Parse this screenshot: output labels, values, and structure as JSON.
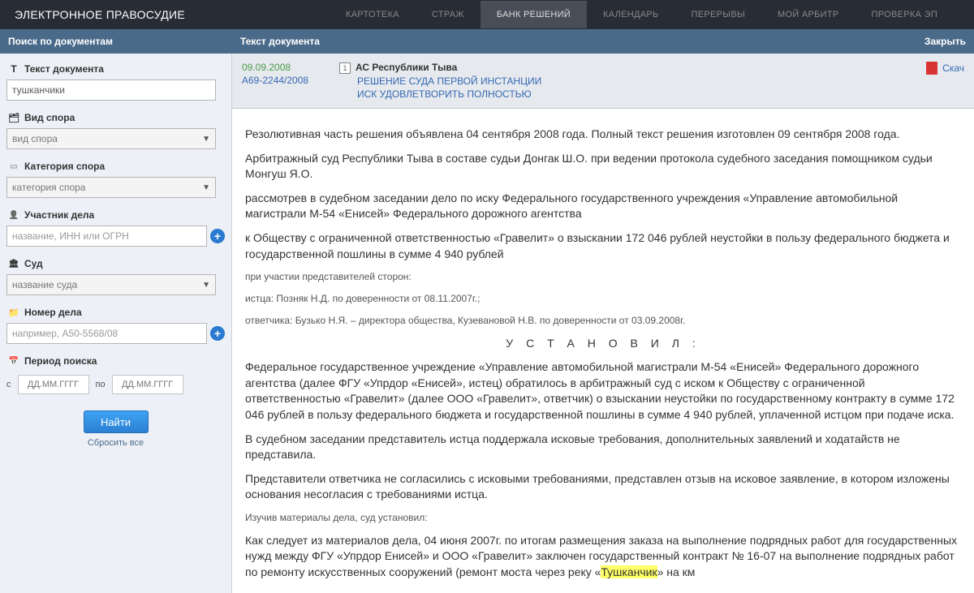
{
  "header": {
    "logo": "ЭЛЕКТРОННОЕ ПРАВОСУДИЕ",
    "nav": [
      {
        "label": "КАРТОТЕКА"
      },
      {
        "label": "СТРАЖ"
      },
      {
        "label": "БАНК РЕШЕНИЙ",
        "active": true
      },
      {
        "label": "КАЛЕНДАРЬ"
      },
      {
        "label": "ПЕРЕРЫВЫ"
      },
      {
        "label": "МОЙ АРБИТР"
      },
      {
        "label": "ПРОВЕРКА ЭП"
      }
    ]
  },
  "subheader": {
    "left": "Поиск по документам",
    "mid": "Текст документа",
    "right": "Закрыть"
  },
  "sidebar": {
    "text_label": "Текст документа",
    "text_value": "тушканчики",
    "type_label": "Вид спора",
    "type_placeholder": "вид спора",
    "cat_label": "Категория спора",
    "cat_placeholder": "категория спора",
    "party_label": "Участник дела",
    "party_placeholder": "название, ИНН или ОГРН",
    "court_label": "Суд",
    "court_placeholder": "название суда",
    "case_label": "Номер дела",
    "case_placeholder": "например, А50-5568/08",
    "period_label": "Период поиска",
    "period_from": "с",
    "period_to": "по",
    "period_placeholder": "ДД.ММ.ГГГГ",
    "find": "Найти",
    "reset": "Сбросить все"
  },
  "doc": {
    "date": "09.09.2008",
    "case_no": "А69-2244/2008",
    "inst_badge": "1",
    "court": "АС Республики Тыва",
    "link1": "РЕШЕНИЕ СУДА ПЕРВОЙ ИНСТАНЦИИ",
    "link2": "ИСК УДОВЛЕТВОРИТЬ ПОЛНОСТЬЮ",
    "download": "Скач",
    "body": {
      "p0": "Резолютивная часть решения объявлена 04 сентября 2008 года. Полный текст решения изготовлен 09 сентября 2008 года.",
      "p1": "Арбитражный суд Республики Тыва в составе судьи Донгак Ш.О. при ведении протокола судебного заседания помощником судьи Монгуш Я.О.",
      "p2": "рассмотрев в судебном заседании дело по иску Федерального государственного учреждения «Управление автомобильной магистрали М-54 «Енисей» Федерального дорожного агентства",
      "p3": "к Обществу с ограниченной ответственностью «Гравелит» о взыскании 172 046 рублей неустойки в пользу федерального бюджета и государственной пошлины в сумме 4 940 рублей",
      "p4": "при участии представителей сторон:",
      "p5": "истца: Позняк Н.Д. по доверенности от 08.11.2007г.;",
      "p6": "ответчика: Бузько Н.Я. – директора общества, Кузевановой Н.В. по доверенности от 03.09.2008г.",
      "p7": "У С Т А Н О В И Л :",
      "p8": "Федеральное государственное учреждение «Управление автомобильной магистрали М-54 «Енисей» Федерального дорожного агентства (далее ФГУ «Упрдор «Енисей», истец) обратилось в арбитражный суд с иском к Обществу с ограниченной ответственностью «Гравелит» (далее ООО «Гравелит», ответчик) о взыскании неустойки по государственному контракту в сумме 172 046 рублей в пользу федерального бюджета и государственной пошлины в сумме 4 940 рублей, уплаченной истцом при подаче иска.",
      "p9": "В судебном заседании представитель истца поддержала исковые требования, дополнительных заявлений и ходатайств не представила.",
      "p10": "Представители ответчика не согласились с исковыми требованиями, представлен отзыв на исковое заявление, в котором изложены основания несогласия с требованиями истца.",
      "p11": "Изучив материалы дела, суд установил:",
      "p12a": "Как следует из материалов дела, 04 июня 2007г. по итогам размещения заказа на выполнение подрядных работ для государственных нужд между ФГУ «Упрдор Енисей» и ООО «Гравелит» заключен государственный контракт № 16-07 на выполнение подрядных работ по ремонту искусственных сооружений (ремонт моста через реку «",
      "highlight": "Тушканчик",
      "p12b": "» на км"
    }
  }
}
